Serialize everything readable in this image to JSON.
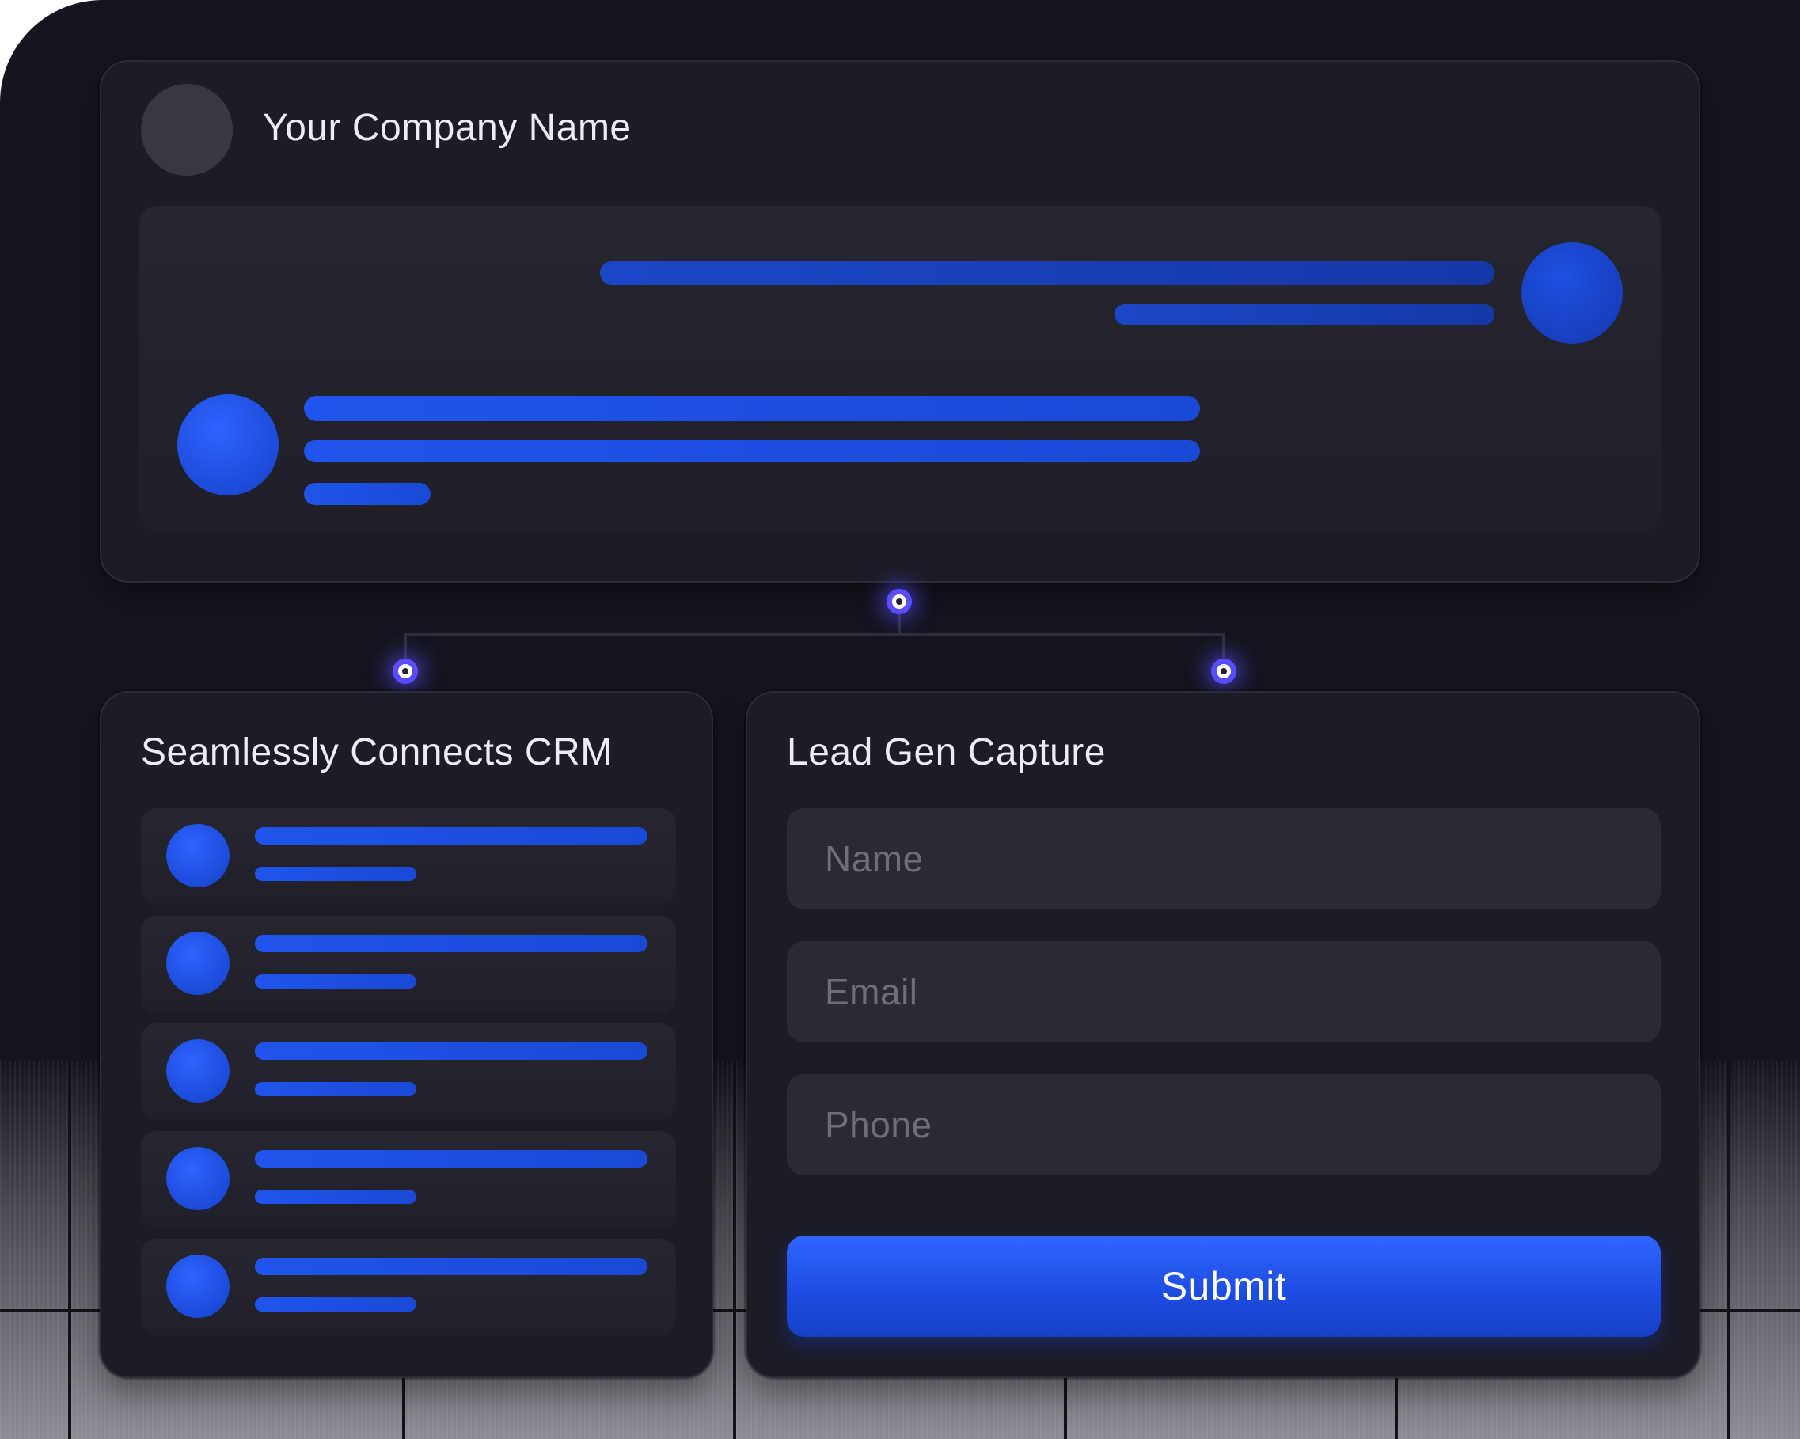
{
  "header": {
    "company_name": "Your Company Name"
  },
  "crm_card": {
    "title": "Seamlessly Connects CRM",
    "row_count": 5
  },
  "lead_form": {
    "title": "Lead Gen Capture",
    "fields": [
      {
        "placeholder": "Name"
      },
      {
        "placeholder": "Email"
      },
      {
        "placeholder": "Phone"
      }
    ],
    "submit_label": "Submit"
  },
  "colors": {
    "background": "#15151f",
    "card": "#1c1c26",
    "accent_blue": "#1f55ec",
    "node_glow": "#5a4cff",
    "field": "#2a2a34"
  },
  "icons": {
    "logo": "logo-placeholder-circle",
    "connector_node": "connector-node-icon"
  }
}
